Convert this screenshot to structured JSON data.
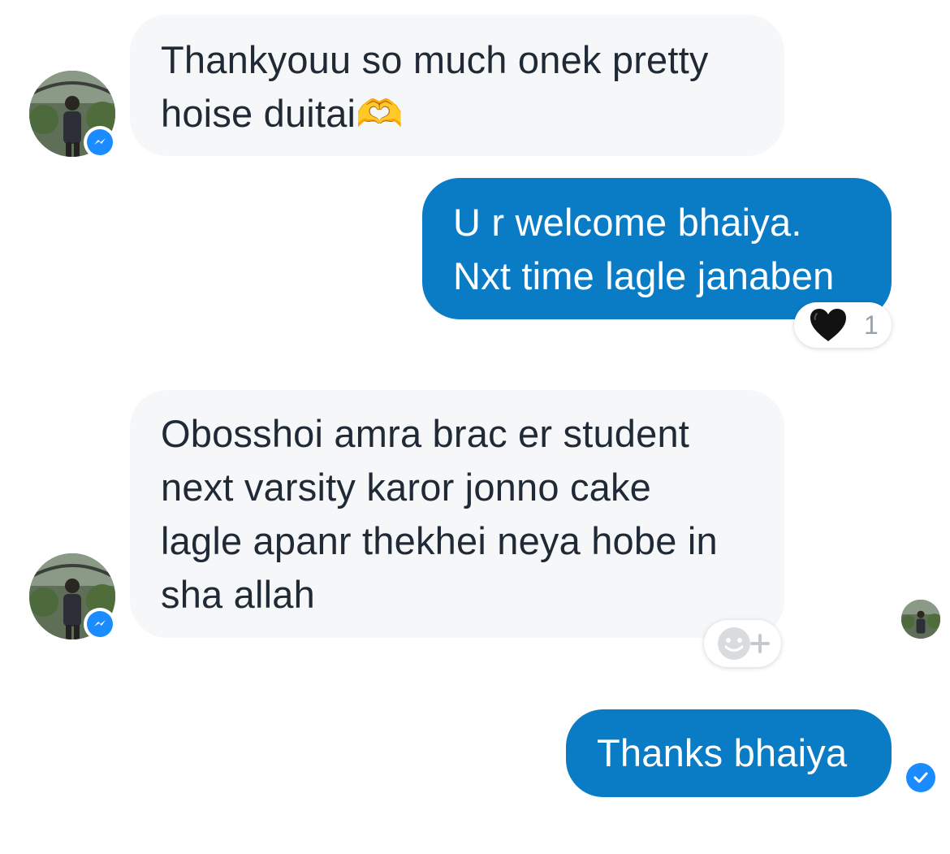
{
  "messages": [
    {
      "direction": "incoming",
      "lines": [
        "Thankyouu so much onek pretty",
        "hoise duitai🫶"
      ]
    },
    {
      "direction": "outgoing",
      "lines": [
        "U r welcome bhaiya.",
        "Nxt time lagle janaben"
      ],
      "reaction": {
        "emoji": "🖤",
        "count": "1"
      }
    },
    {
      "direction": "incoming",
      "lines": [
        "Obosshoi amra brac er student",
        "next varsity karor jonno cake",
        "lagle apanr thekhei neya hobe in",
        "sha allah"
      ]
    },
    {
      "direction": "outgoing",
      "lines": [
        "Thanks bhaiya"
      ]
    }
  ],
  "icons": {
    "sender_badge": "messenger-icon",
    "add_reaction": "add-reaction-icon",
    "read_receipt": "seen-avatar-icon",
    "delivered": "check-circle-icon"
  },
  "colors": {
    "outgoing_bubble": "#0a7cc6",
    "incoming_bubble": "#f5f7f9",
    "incoming_text": "#1f2a36",
    "badge_blue": "#1a8cff"
  }
}
